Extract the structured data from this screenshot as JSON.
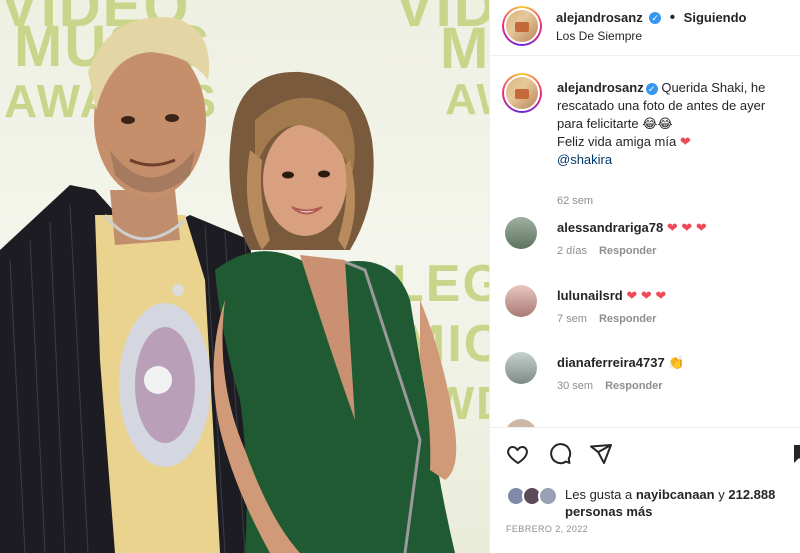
{
  "header": {
    "username": "alejandrosanz",
    "verified_mark": "✓",
    "follow_status": "Siguiendo",
    "location": "Los De Siempre"
  },
  "caption": {
    "username": "alejandrosanz",
    "text_1": "Querida Shaki, he rescatado una foto de antes de ayer para felicitarte 😂😂",
    "text_2": "Feliz vida amiga mía",
    "heart": "❤",
    "mention": "@shakira",
    "time": "62 sem"
  },
  "comments": [
    {
      "username": "alessandrariga78",
      "text": "❤ ❤ ❤",
      "time": "2 días",
      "reply": "Responder"
    },
    {
      "username": "lulunailsrd",
      "text": "❤ ❤ ❤",
      "time": "7 sem",
      "reply": "Responder"
    },
    {
      "username": "dianaferreira4737",
      "text": "👏",
      "time": "30 sem",
      "reply": "Responder"
    }
  ],
  "actions": {
    "icons": [
      "heart-icon",
      "comment-icon",
      "share-icon"
    ]
  },
  "likes": {
    "prefix": "Les gusta a",
    "user": "nayibcanaan",
    "connector": "y",
    "count": "212.888",
    "suffix": "personas más"
  },
  "date": "FEBRERO 2, 2022",
  "photo_bg_text": {
    "top": "VIDEO",
    "music": "MUSIC",
    "awards": "AWARDS",
    "right_top": "VIDEO",
    "right_mus": "MUSIC",
    "right_awa": "AWARDS",
    "lat1": "LEG",
    "lat2": "MIC",
    "lat3": "AWDS"
  },
  "colors": {
    "link": "#00376b",
    "heart": "#ed4956",
    "verified": "#3897f0",
    "muted": "#8e8e8e"
  }
}
